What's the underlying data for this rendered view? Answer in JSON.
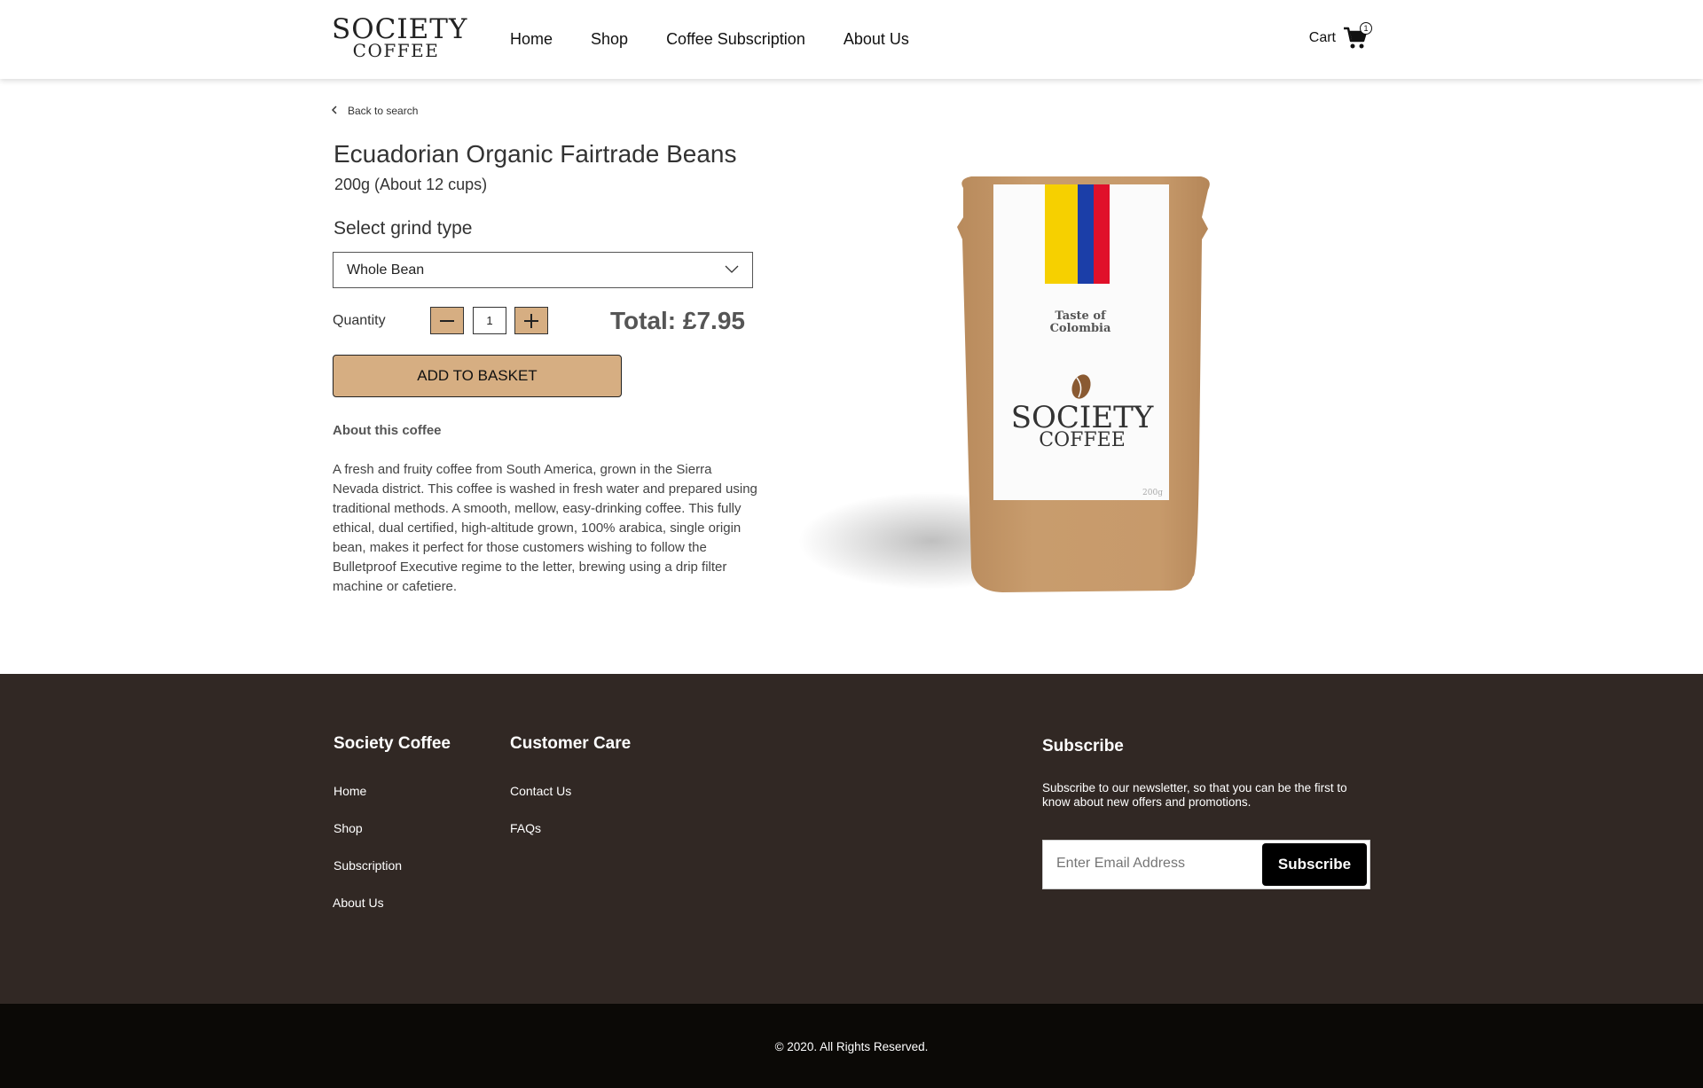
{
  "header": {
    "logo": {
      "line1": "SOCIETY",
      "line2": "COFFEE"
    },
    "nav": [
      "Home",
      "Shop",
      "Coffee Subscription",
      "About Us"
    ],
    "cart_label": "Cart",
    "cart_count": "1"
  },
  "product": {
    "back_label": "Back to search",
    "title": "Ecuadorian Organic Fairtrade Beans",
    "subtitle": "200g (About 12 cups)",
    "grind_label": "Select grind type",
    "grind_selected": "Whole Bean",
    "quantity_label": "Quantity",
    "quantity_value": "1",
    "total": "Total: £7.95",
    "add_button": "ADD TO BASKET",
    "about_heading": "About this coffee",
    "about_text": "A fresh and fruity coffee from South America, grown in the Sierra Nevada district. This coffee is washed in fresh water and prepared using traditional methods. A smooth, mellow, easy-drinking coffee. This fully ethical, dual certified, high-altitude grown, 100% arabica, single origin bean, makes it perfect for those customers wishing to follow the Bulletproof Executive regime to the letter, brewing using a drip filter machine or cafetiere.",
    "image": {
      "label_line1": "Taste of",
      "label_line2": "Colombia",
      "brand_line1": "SOCIETY",
      "brand_line2": "COFFEE",
      "weight": "200g",
      "flag_colors": [
        "#f6d000",
        "#1b3ea8",
        "#e0102a"
      ],
      "bag_color": "#c59a6b"
    }
  },
  "footer": {
    "col1": {
      "title": "Society Coffee",
      "links": [
        "Home",
        "Shop",
        "Subscription",
        "About Us"
      ]
    },
    "col2": {
      "title": "Customer Care",
      "links": [
        "Contact Us",
        "FAQs"
      ]
    },
    "subscribe": {
      "title": "Subscribe",
      "text": "Subscribe to our newsletter, so that you can be the first to know about new offers and promotions.",
      "placeholder": "Enter Email Address",
      "button": "Subscribe"
    },
    "copyright": "© 2020. All Rights Reserved."
  },
  "colors": {
    "accent": "#d6ae82",
    "footer_bg": "#312824",
    "bottom_bar_bg": "#0b0906"
  }
}
